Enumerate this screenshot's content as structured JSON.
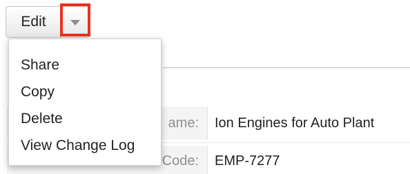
{
  "toolbar": {
    "edit_label": "Edit",
    "caret_icon": "caret-down-icon",
    "highlight_color": "#e8321f"
  },
  "menu": {
    "items": [
      {
        "label": "Share"
      },
      {
        "label": "Copy"
      },
      {
        "label": "Delete"
      },
      {
        "label": "View Change Log"
      }
    ]
  },
  "detail": {
    "fields": [
      {
        "label": "ame:",
        "value": "Ion Engines for Auto Plant"
      },
      {
        "label": "Code:",
        "value": "EMP-7277"
      }
    ]
  }
}
